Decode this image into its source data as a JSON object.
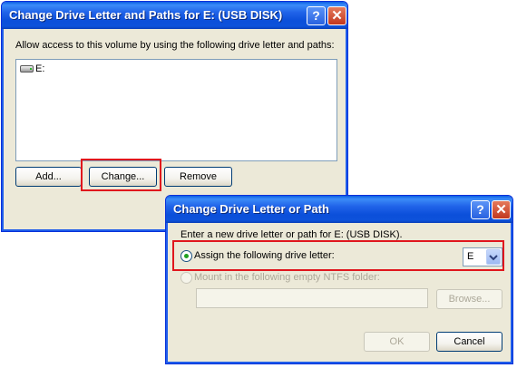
{
  "dialog1": {
    "title": "Change Drive Letter and Paths for E: (USB DISK)",
    "help_glyph": "?",
    "close_glyph": "✕",
    "description": "Allow access to this volume by using the following drive letter and paths:",
    "entries": [
      {
        "label": "E:",
        "icon": "drive-icon"
      }
    ],
    "add_label": "Add...",
    "change_label": "Change...",
    "remove_label": "Remove"
  },
  "dialog2": {
    "title": "Change Drive Letter or Path",
    "help_glyph": "?",
    "close_glyph": "✕",
    "prompt": "Enter a new drive letter or path for E: (USB DISK).",
    "assign_label": "Assign the following drive letter:",
    "assign_checked": true,
    "drive_letter": "E",
    "mount_label": "Mount in the following empty NTFS folder:",
    "mount_enabled": false,
    "folder_value": "",
    "browse_label": "Browse...",
    "ok_label": "OK",
    "cancel_label": "Cancel"
  },
  "colors": {
    "highlight_box": "#e0161d",
    "titlebar_blue": "#0b4fda",
    "dialog_face": "#ece9d8"
  }
}
